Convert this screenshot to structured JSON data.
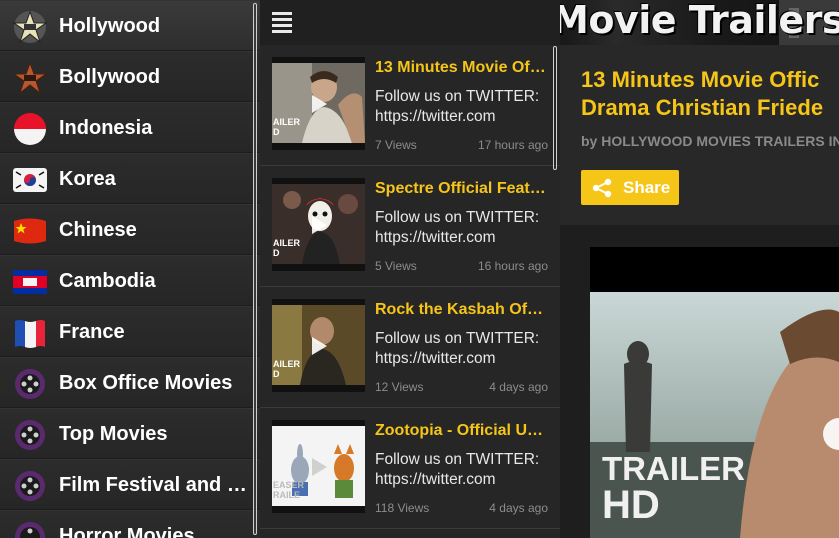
{
  "sidebar": {
    "items": [
      {
        "label": "Hollywood",
        "icon": "hollywood-star-icon",
        "active": true
      },
      {
        "label": "Bollywood",
        "icon": "bollywood-star-icon"
      },
      {
        "label": "Indonesia",
        "icon": "indonesia-flag-icon"
      },
      {
        "label": "Korea",
        "icon": "korea-flag-icon"
      },
      {
        "label": "Chinese",
        "icon": "china-flag-icon"
      },
      {
        "label": "Cambodia",
        "icon": "cambodia-flag-icon"
      },
      {
        "label": "France",
        "icon": "france-flag-icon"
      },
      {
        "label": "Box Office Movies",
        "icon": "film-reel-icon"
      },
      {
        "label": "Top Movies",
        "icon": "film-reel-icon"
      },
      {
        "label": "Film Festival and I…",
        "icon": "film-reel-icon"
      },
      {
        "label": "Horror Movies",
        "icon": "film-reel-icon"
      }
    ]
  },
  "list": {
    "videos": [
      {
        "title": "13 Minutes Movie Of…",
        "desc_line1": "Follow us on TWITTER:",
        "desc_line2": "https://twitter.com",
        "views": "7 Views",
        "time": "17 hours ago"
      },
      {
        "title": "Spectre Official Feat…",
        "desc_line1": "Follow us on TWITTER:",
        "desc_line2": "https://twitter.com",
        "views": "5 Views",
        "time": "16 hours ago"
      },
      {
        "title": "Rock the Kasbah Of…",
        "desc_line1": "Follow us on TWITTER:",
        "desc_line2": "https://twitter.com",
        "views": "12 Views",
        "time": "4 days ago"
      },
      {
        "title": "Zootopia - Official U…",
        "desc_line1": "Follow us on TWITTER:",
        "desc_line2": "https://twitter.com",
        "views": "118 Views",
        "time": "4 days ago"
      }
    ],
    "thumb_caption": "AILER"
  },
  "banner": {
    "text": "Movie Trailers"
  },
  "detail": {
    "title_line1": "13 Minutes Movie Offic",
    "title_line2": "Drama Christian Friede",
    "byline": "by HOLLYWOOD MOVIES TRAILERS IN",
    "share_label": "Share"
  },
  "player": {
    "overlay_line1": "TRAILER",
    "overlay_line2": "HD"
  },
  "colors": {
    "accent": "#f5c518",
    "background": "#262626"
  }
}
